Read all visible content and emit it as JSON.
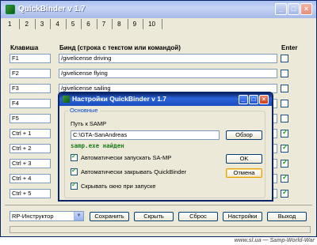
{
  "window": {
    "title": "QuickBinder v 1.7",
    "buttons": {
      "minimize": "_",
      "maximize": "□",
      "close": "×"
    }
  },
  "tabs": [
    "1",
    "2",
    "3",
    "4",
    "5",
    "6",
    "7",
    "8",
    "9",
    "10"
  ],
  "grid": {
    "col_key": "Клавиша",
    "col_bind": "Бинд (строка с текстом или командой)",
    "col_enter": "Enter",
    "rows": [
      {
        "key": "F1",
        "bind": "/givelicense driving",
        "enter": false
      },
      {
        "key": "F2",
        "bind": "/givelicense flying",
        "enter": false
      },
      {
        "key": "F3",
        "bind": "/givelicense sailing",
        "enter": false
      },
      {
        "key": "F4",
        "bind": "",
        "enter": false
      },
      {
        "key": "F5",
        "bind": "",
        "enter": false
      },
      {
        "key": "Ctrl + 1",
        "bind": "",
        "enter": true
      },
      {
        "key": "Ctrl + 2",
        "bind": "",
        "enter": true
      },
      {
        "key": "Ctrl + 3",
        "bind": "",
        "enter": true
      },
      {
        "key": "Ctrl + 4",
        "bind": "",
        "enter": true
      },
      {
        "key": "Ctrl + 5",
        "bind": "",
        "enter": true
      }
    ]
  },
  "bottom": {
    "profile": "RP-Инструктор",
    "save": "Сохранить",
    "hide": "Скрыть",
    "reset": "Сброс",
    "settings": "Настройки",
    "exit": "Выход"
  },
  "dialog": {
    "title": "Настройки QuickBinder v 1.7",
    "group": "Основные",
    "path_label": "Путь к SAMP",
    "path_value": "C:\\GTA-SanAndreas",
    "browse": "Обзор",
    "found": "samp.exe найден",
    "opt_autostart": "Автоматически запускать SA-MP",
    "opt_autoclose": "Автоматически закрывать QuickBinder",
    "opt_hide": "Скрывать окно при запуске",
    "opt_autostart_checked": true,
    "opt_autoclose_checked": true,
    "opt_hide_checked": true,
    "ok": "OK",
    "cancel": "Отмена"
  },
  "watermark": "www.sl.ua — Samp-World-War",
  "colors": {
    "accent": "#0a246a",
    "found_text": "#1d7d1d",
    "group_legend": "#0046d5"
  }
}
